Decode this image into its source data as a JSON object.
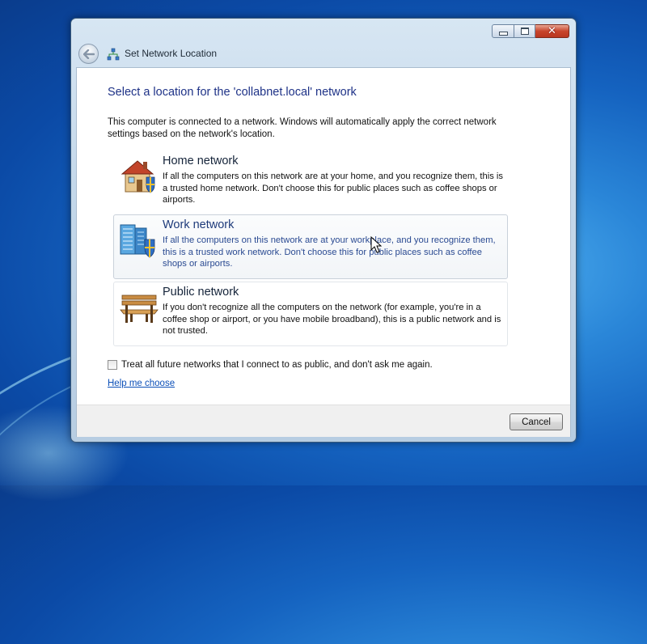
{
  "window": {
    "title": "Set Network Location",
    "controls": {
      "minimize": "minimize",
      "maximize": "maximize",
      "close": "✕"
    }
  },
  "heading": "Select a location for the 'collabnet.local' network",
  "description": "This computer is connected to a network. Windows will automatically apply the correct network settings based on the network's location.",
  "options": [
    {
      "title": "Home network",
      "description": "If all the computers on this network are at your home, and you recognize them, this is a trusted home network.  Don't choose this for public places such as coffee shops or airports.",
      "icon": "house-icon"
    },
    {
      "title": "Work network",
      "description": "If all the computers on this network are at your workplace, and you recognize them, this is a trusted work network.  Don't choose this for public places such as coffee shops or airports.",
      "icon": "office-building-icon"
    },
    {
      "title": "Public network",
      "description": "If you don't recognize all the computers on the network (for example, you're in a coffee shop or airport, or you have mobile broadband), this is a public network and is not trusted.",
      "icon": "park-bench-icon"
    }
  ],
  "checkbox": {
    "label": "Treat all future networks that I connect to as public, and don't ask me again.",
    "checked": false
  },
  "help_link": "Help me choose",
  "cancel_button": "Cancel",
  "colors": {
    "heading": "#1e3287",
    "link": "#0b4fb8",
    "hover_text": "#2a4a92"
  }
}
